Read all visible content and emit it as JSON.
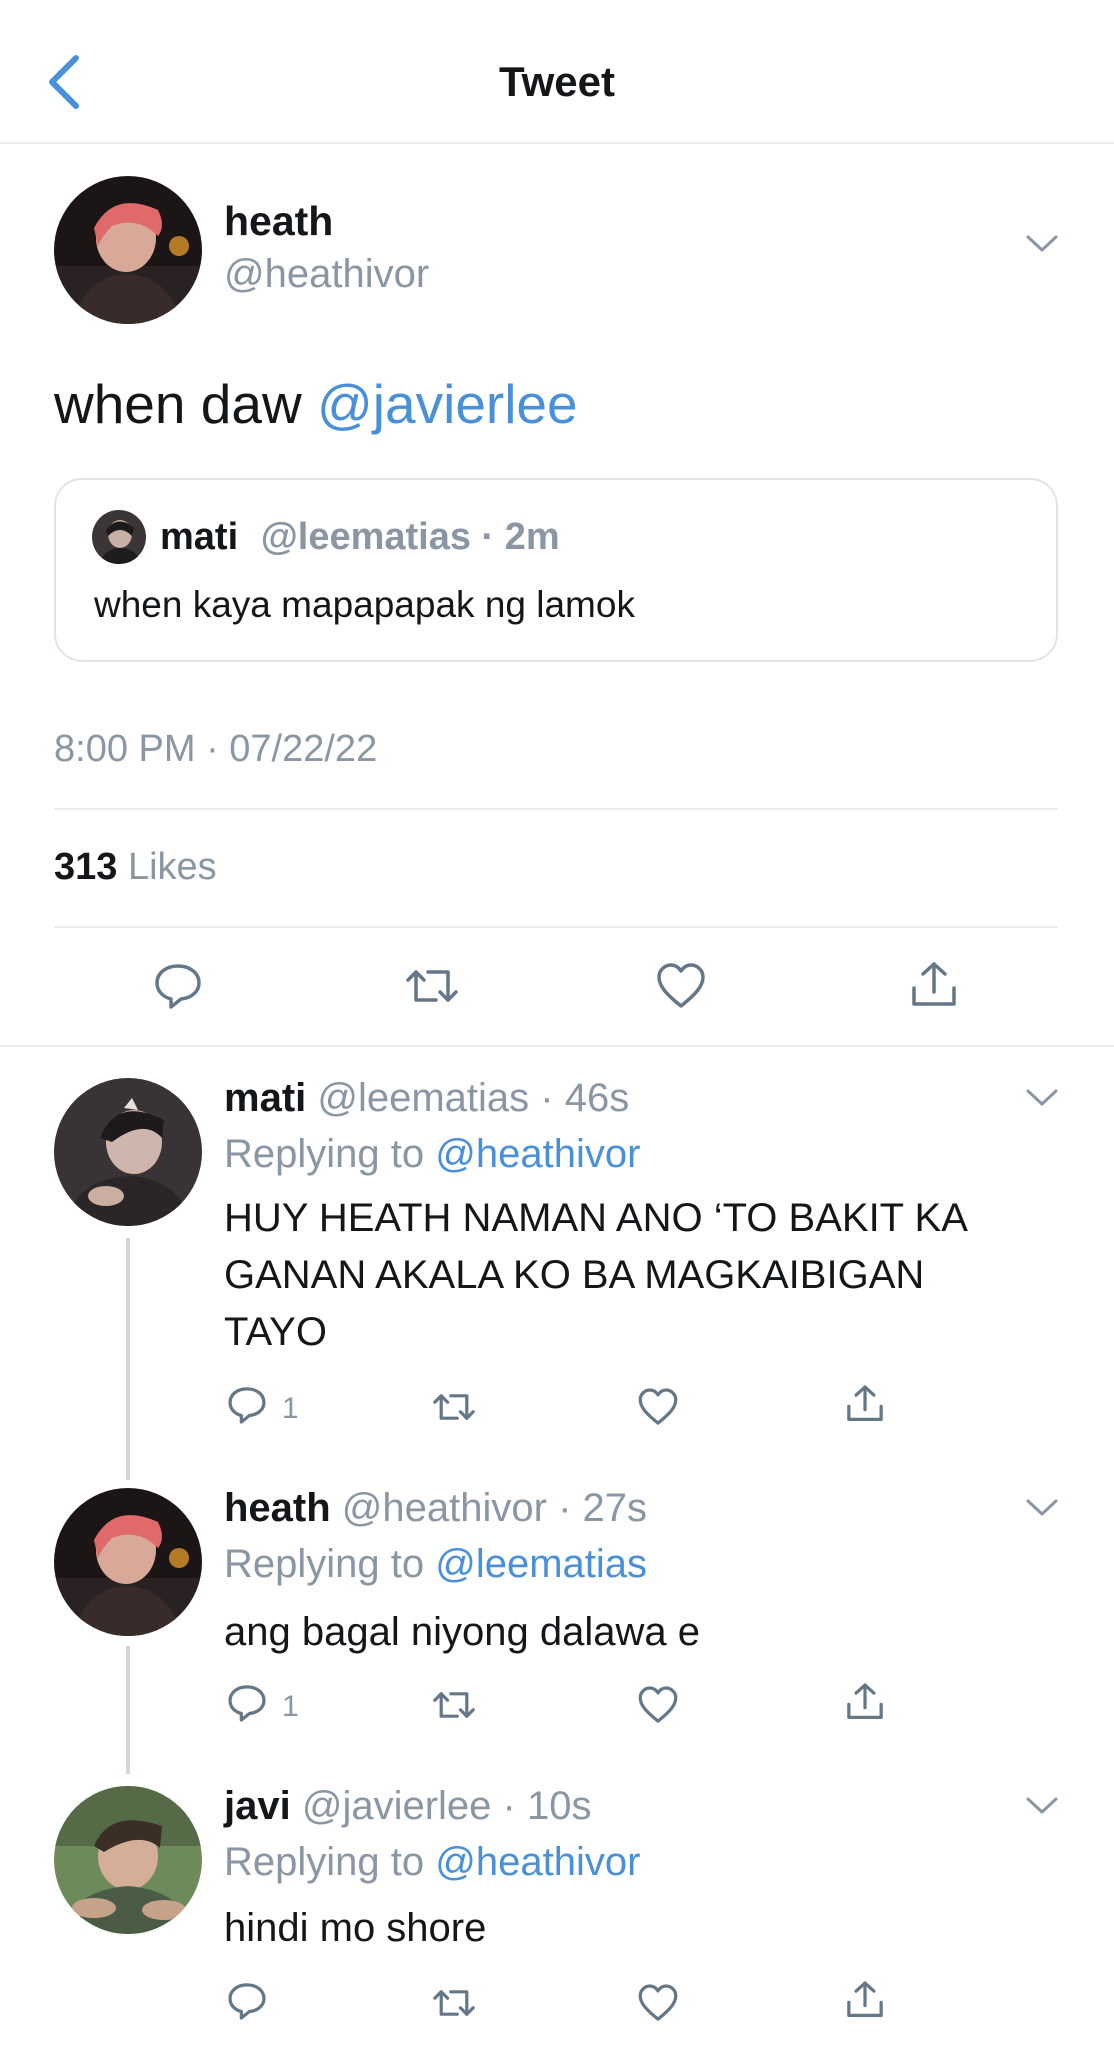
{
  "header": {
    "title": "Tweet",
    "back_icon": "chevron-left-icon"
  },
  "colors": {
    "accent": "#4a90d9",
    "secondary_text": "#8a96a3",
    "divider": "#e6ecf0"
  },
  "main_tweet": {
    "name": "heath",
    "handle": "@heathivor",
    "text_prefix": "when daw ",
    "text_mention": "@javierlee",
    "quote": {
      "name": "mati",
      "handle": "@leematias",
      "separator": " · ",
      "time": "2m",
      "text": "when kaya mapapapak ng lamok"
    },
    "timestamp": "8:00 PM · 07/22/22",
    "likes_count": "313",
    "likes_label": " Likes"
  },
  "replies": [
    {
      "name": "mati",
      "handle": " @leematias",
      "time": " · 46s",
      "replying_prefix": "Replying to ",
      "replying_to": "@heathivor",
      "lines": [
        "HUY HEATH NAMAN ANO ‘TO BAKIT KA",
        "GANAN AKALA KO BA MAGKAIBIGAN",
        "TAYO"
      ],
      "reply_count": "1"
    },
    {
      "name": "heath",
      "handle": " @heathivor",
      "time": " · 27s",
      "replying_prefix": "Replying to ",
      "replying_to": "@leematias",
      "lines": [
        "ang bagal niyong dalawa e"
      ],
      "reply_count": "1"
    },
    {
      "name": "javi",
      "handle": " @javierlee",
      "time": " · 10s",
      "replying_prefix": "Replying to ",
      "replying_to": "@heathivor",
      "lines": [
        "hindi mo shore"
      ],
      "reply_count": ""
    }
  ]
}
